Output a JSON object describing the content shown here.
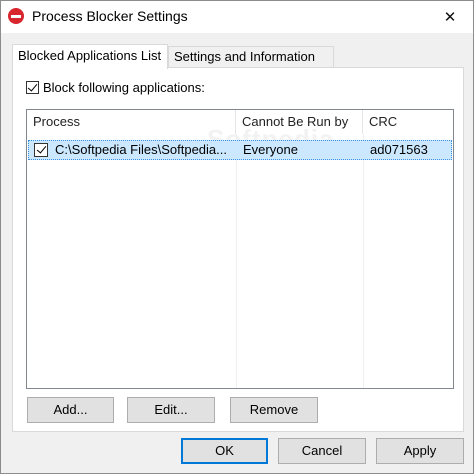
{
  "window": {
    "title": "Process Blocker Settings",
    "close_glyph": "✕",
    "icon": "stop-icon",
    "icon_color": "#d8262e"
  },
  "tabs": [
    {
      "label": "Blocked Applications List",
      "active": true
    },
    {
      "label": "Settings and Information",
      "active": false
    }
  ],
  "block_checkbox": {
    "label": "Block following applications:",
    "checked": true
  },
  "list": {
    "columns": [
      "Process",
      "Cannot Be Run by",
      "CRC"
    ],
    "rows": [
      {
        "checked": true,
        "process": "C:\\Softpedia Files\\Softpedia...",
        "run_by": "Everyone",
        "crc": "ad071563",
        "selected": true
      }
    ],
    "selection_color": "#cce8ff"
  },
  "list_buttons": {
    "add": "Add...",
    "edit": "Edit...",
    "remove": "Remove"
  },
  "dialog_buttons": {
    "ok": "OK",
    "cancel": "Cancel",
    "apply": "Apply"
  },
  "watermark": "Softpedia"
}
